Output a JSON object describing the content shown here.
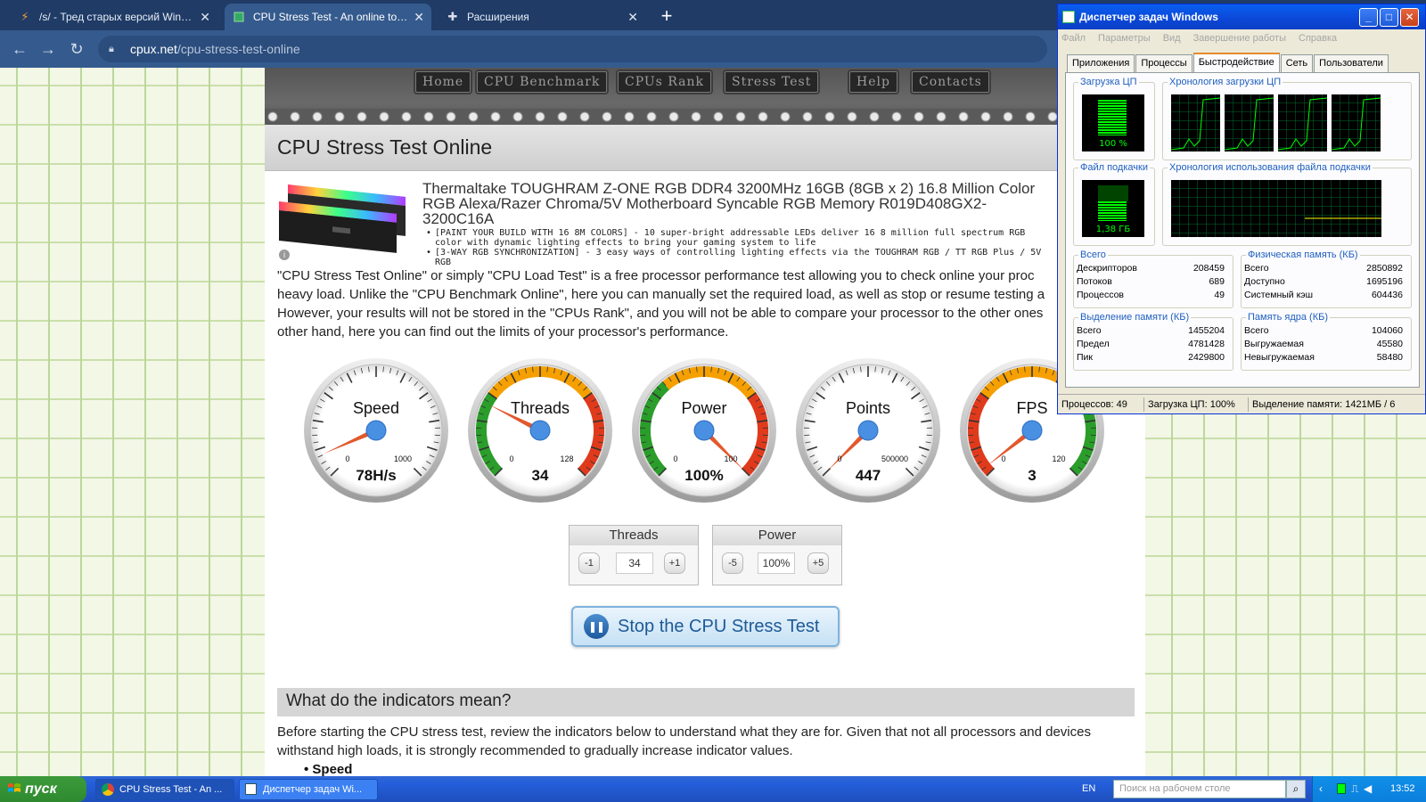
{
  "browser": {
    "tabs": [
      {
        "label": "/s/ - Тред старых версий Window",
        "icon": "lightning-icon",
        "active": false
      },
      {
        "label": "CPU Stress Test - An online tool to t",
        "icon": "chip-icon",
        "active": true
      },
      {
        "label": "Расширения",
        "icon": "puzzle-icon",
        "active": false
      }
    ],
    "url_host": "cpux.net",
    "url_path": "/cpu-stress-test-online"
  },
  "site": {
    "nav": [
      "Home",
      "CPU Benchmark",
      "CPUs Rank",
      "Stress Test",
      "Help",
      "Contacts"
    ],
    "page_title": "CPU Stress Test Online",
    "ad_title": "Thermaltake TOUGHRAM Z-ONE RGB DDR4 3200MHz 16GB (8GB x 2) 16.8 Million Color RGB Alexa/Razer Chroma/5V Motherboard Syncable RGB Memory R019D408GX2-3200C16A",
    "ad_bullets": [
      "[PAINT YOUR BUILD WITH 16 8M COLORS] - 10 super-bright addressable LEDs deliver 16 8 million full spectrum RGB color with dynamic lighting effects to bring your gaming system to life",
      "[3-WAY RGB SYNCHRONIZATION] - 3 easy ways of controlling lighting effects via the TOUGHRAM RGB / TT RGB Plus / 5V RGB"
    ],
    "ad_info": "i",
    "intro": "\"CPU Stress Test Online\" or simply \"CPU Load Test\" is a free processor performance test allowing you to check online your proc heavy load. Unlike the \"CPU Benchmark Online\", here you can manually set the required load, as well as stop or resume testing a However, your results will not be stored in the \"CPUs Rank\", and you will not be able to compare your processor to the other ones other hand, here you can find out the limits of your processor's performance.",
    "gauges": [
      {
        "name": "Speed",
        "min": "0",
        "max": "1000",
        "value": 78,
        "display": "78H/s"
      },
      {
        "name": "Threads",
        "min": "0",
        "max": "128",
        "value": 34,
        "display": "34"
      },
      {
        "name": "Power",
        "min": "0",
        "max": "100",
        "value": 100,
        "display": "100%"
      },
      {
        "name": "Points",
        "min": "0",
        "max": "500000",
        "value": 447,
        "display": "447"
      },
      {
        "name": "FPS",
        "min": "0",
        "max": "120",
        "value": 3,
        "display": "3"
      }
    ],
    "threads_ctrl": {
      "title": "Threads",
      "dec": "-1",
      "value": "34",
      "inc": "+1"
    },
    "power_ctrl": {
      "title": "Power",
      "dec": "-5",
      "value": "100%",
      "inc": "+5"
    },
    "stop_button": "Stop the CPU Stress Test",
    "section_heading": "What do the indicators mean?",
    "section_text": "Before starting the CPU stress test, review the indicators below to understand what they are for. Given that not all processors and devices withstand high loads, it is strongly recommended to gradually increase indicator values.",
    "first_bullet": "Speed"
  },
  "taskmgr": {
    "title": "Диспетчер задач Windows",
    "menu": [
      "Файл",
      "Параметры",
      "Вид",
      "Завершение работы",
      "Справка"
    ],
    "tabs": [
      "Приложения",
      "Процессы",
      "Быстродействие",
      "Сеть",
      "Пользователи"
    ],
    "cpu_label": "Загрузка ЦП",
    "cpu_value": "100 %",
    "cpu_history_label": "Хронология загрузки ЦП",
    "pf_label": "Файл подкачки",
    "pf_value": "1,38 ГБ",
    "pf_history_label": "Хронология использования файла подкачки",
    "totals": {
      "label": "Всего",
      "rows": [
        [
          "Дескрипторов",
          "208459"
        ],
        [
          "Потоков",
          "689"
        ],
        [
          "Процессов",
          "49"
        ]
      ]
    },
    "physmem": {
      "label": "Физическая память (КБ)",
      "rows": [
        [
          "Всего",
          "2850892"
        ],
        [
          "Доступно",
          "1695196"
        ],
        [
          "Системный кэш",
          "604436"
        ]
      ]
    },
    "commit": {
      "label": "Выделение памяти (КБ)",
      "rows": [
        [
          "Всего",
          "1455204"
        ],
        [
          "Предел",
          "4781428"
        ],
        [
          "Пик",
          "2429800"
        ]
      ]
    },
    "kernel": {
      "label": "Память ядра (КБ)",
      "rows": [
        [
          "Всего",
          "104060"
        ],
        [
          "Выгружаемая",
          "45580"
        ],
        [
          "Невыгружаемая",
          "58480"
        ]
      ]
    },
    "status": [
      "Процессов: 49",
      "Загрузка ЦП: 100%",
      "Выделение памяти: 1421МБ / 6"
    ]
  },
  "taskbar": {
    "start": "пуск",
    "buttons": [
      "CPU Stress Test - An ...",
      "Диспетчер задач Wi..."
    ],
    "lang": "EN",
    "search_placeholder": "Поиск на рабочем столе",
    "clock": "13:52"
  }
}
